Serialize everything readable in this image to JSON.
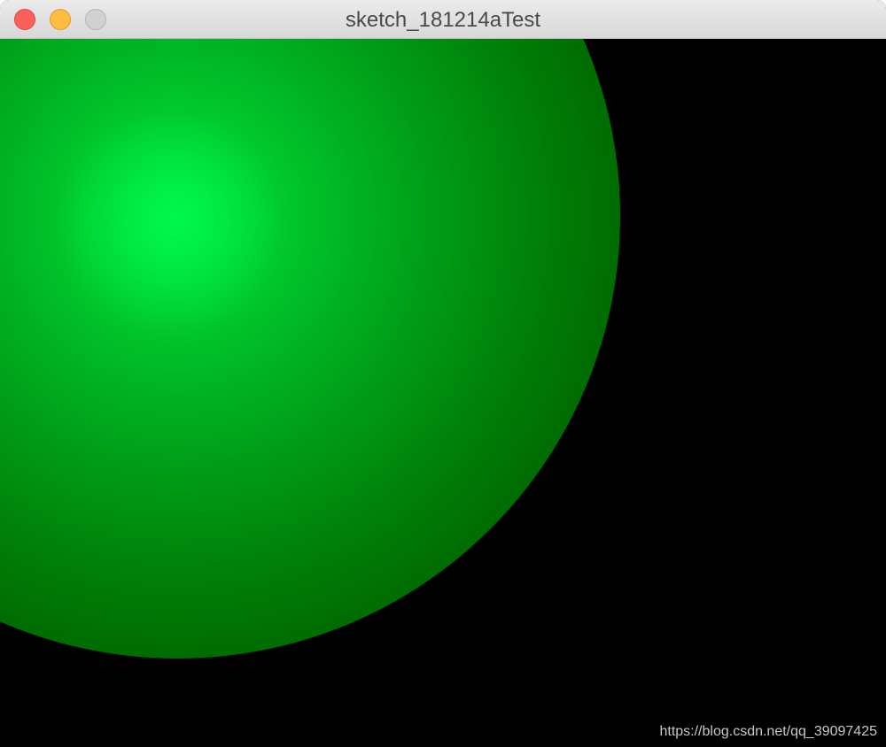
{
  "window": {
    "title": "sketch_181214aTest"
  },
  "titlebar": {
    "buttons": [
      {
        "name": "close",
        "color": "#fc605c"
      },
      {
        "name": "minimize",
        "color": "#fdbc40"
      },
      {
        "name": "zoom",
        "color": "#d1d1d1"
      }
    ]
  },
  "canvas": {
    "background_color": "#000000",
    "sphere_highlight_color": "#00f04a",
    "sphere_shadow_color": "#004c00"
  },
  "watermark": {
    "text": "https://blog.csdn.net/qq_39097425"
  }
}
